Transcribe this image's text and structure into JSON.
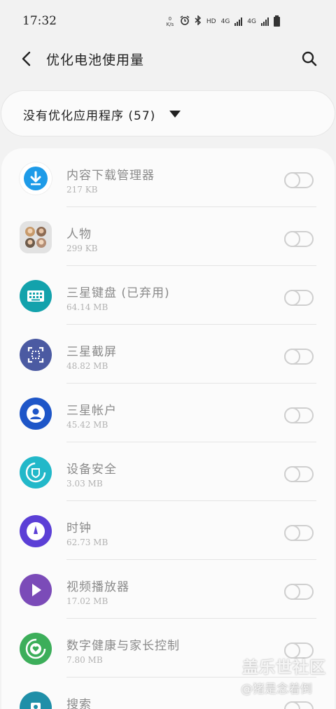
{
  "status_bar": {
    "time": "17:32",
    "net_speed": "0 K/s",
    "hd": "HD",
    "net1": "4G",
    "net2": "4G"
  },
  "header": {
    "title": "优化电池使用量"
  },
  "filter": {
    "label": "没有优化应用程序 (57)"
  },
  "apps": [
    {
      "name": "内容下载管理器",
      "size": "217 KB",
      "icon": "download-icon",
      "color": "#1e9be8"
    },
    {
      "name": "人物",
      "size": "299 KB",
      "icon": "people-icon",
      "color": "#dcdcdc"
    },
    {
      "name": "三星键盘 (已弃用)",
      "size": "64.14 MB",
      "icon": "keyboard-icon",
      "color": "#13a2ac"
    },
    {
      "name": "三星截屏",
      "size": "48.82 MB",
      "icon": "screenshot-icon",
      "color": "#4b5aa2"
    },
    {
      "name": "三星帐户",
      "size": "45.42 MB",
      "icon": "account-icon",
      "color": "#1e56c8"
    },
    {
      "name": "设备安全",
      "size": "3.03 MB",
      "icon": "shield-icon",
      "color": "#22b8c9"
    },
    {
      "name": "时钟",
      "size": "62.73 MB",
      "icon": "clock-icon",
      "color": "#5b3fd6"
    },
    {
      "name": "视频播放器",
      "size": "17.02 MB",
      "icon": "play-icon",
      "color": "#7b4bb8"
    },
    {
      "name": "数字健康与家长控制",
      "size": "7.80 MB",
      "icon": "wellbeing-icon",
      "color": "#3cae5a"
    },
    {
      "name": "搜索",
      "size": "",
      "icon": "search-app-icon",
      "color": "#1f8fa8"
    }
  ],
  "watermark": {
    "title": "盖乐世社区",
    "user": "@猪是念着倒"
  }
}
